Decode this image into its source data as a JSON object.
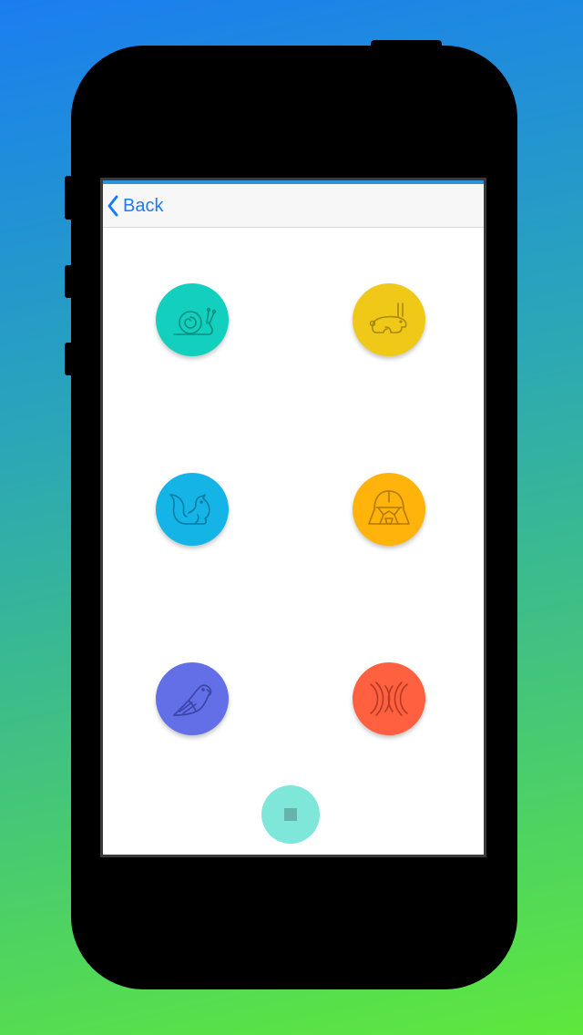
{
  "nav": {
    "back_label": "Back",
    "accent": "#1b7cf2"
  },
  "grid": [
    {
      "name": "snail",
      "icon": "snail-icon",
      "color": "#12cfbe",
      "stroke": "#0a8d82"
    },
    {
      "name": "rabbit",
      "icon": "rabbit-icon",
      "color": "#f0c918",
      "stroke": "#a78a0c"
    },
    {
      "name": "squirrel",
      "icon": "squirrel-icon",
      "color": "#14b5e6",
      "stroke": "#0a7aa0"
    },
    {
      "name": "darth-vader",
      "icon": "darth-vader-icon",
      "color": "#ffb30b",
      "stroke": "#b07a05"
    },
    {
      "name": "parrot",
      "icon": "parrot-icon",
      "color": "#626fe6",
      "stroke": "#3b44a8"
    },
    {
      "name": "waves",
      "icon": "wave-pattern-icon",
      "color": "#ff6040",
      "stroke": "#b43a22"
    }
  ],
  "fab": {
    "icon": "stop-icon",
    "color": "#7fe6da"
  }
}
